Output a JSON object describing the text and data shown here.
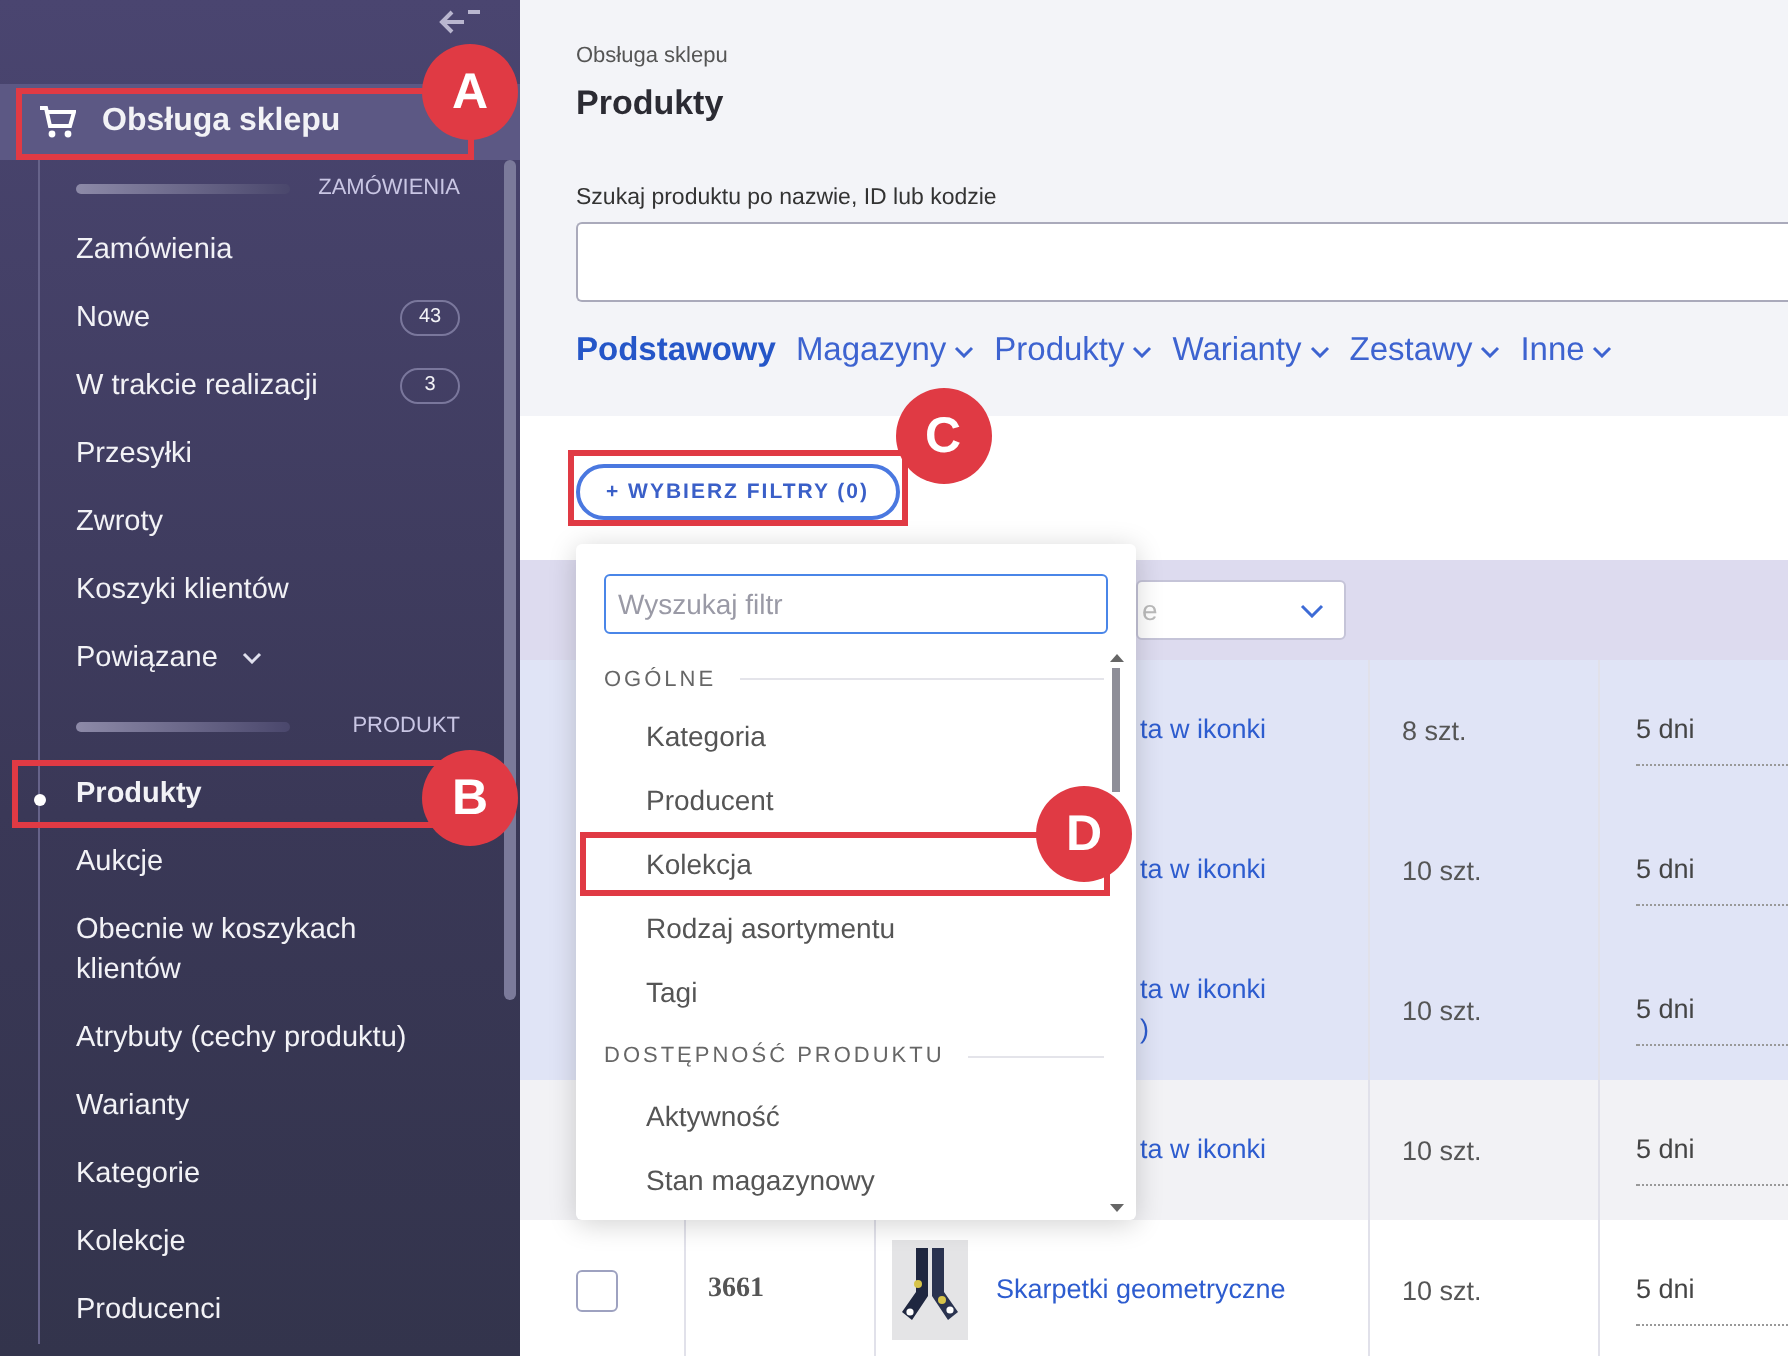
{
  "sidebar": {
    "module": {
      "label": "Obsługa sklepu",
      "selected": true,
      "annotation": "A"
    },
    "sections": [
      {
        "title": "ZAMÓWIENIA",
        "items": [
          {
            "label": "Zamówienia",
            "selected": false
          },
          {
            "label": "Nowe",
            "badge": "43",
            "selected": false
          },
          {
            "label": "W trakcie realizacji",
            "badge": "3",
            "selected": false
          },
          {
            "label": "Przesyłki",
            "selected": false
          },
          {
            "label": "Zwroty",
            "selected": false
          },
          {
            "label": "Koszyki klientów",
            "selected": false
          },
          {
            "label": "Powiązane",
            "selected": false,
            "expandable": true
          }
        ]
      },
      {
        "title": "PRODUKT",
        "items": [
          {
            "label": "Produkty",
            "selected": true,
            "annotation": "B"
          },
          {
            "label": "Aukcje",
            "selected": false
          },
          {
            "label": "Obecnie w koszykach klientów",
            "selected": false
          },
          {
            "label": "Atrybuty (cechy produktu)",
            "selected": false
          },
          {
            "label": "Warianty",
            "selected": false
          },
          {
            "label": "Kategorie",
            "selected": false
          },
          {
            "label": "Kolekcje",
            "selected": false
          },
          {
            "label": "Producenci",
            "selected": false
          }
        ]
      }
    ]
  },
  "breadcrumb": "Obsługa sklepu",
  "page_title": "Produkty",
  "search": {
    "label": "Szukaj produktu po nazwie, ID lub kodzie"
  },
  "tabs": [
    {
      "label": "Podstawowy",
      "selected": true,
      "has_menu": false
    },
    {
      "label": "Magazyny",
      "selected": false,
      "has_menu": true
    },
    {
      "label": "Produkty",
      "selected": false,
      "has_menu": true
    },
    {
      "label": "Warianty",
      "selected": false,
      "has_menu": true
    },
    {
      "label": "Zestawy",
      "selected": false,
      "has_menu": true
    },
    {
      "label": "Inne",
      "selected": false,
      "has_menu": true
    }
  ],
  "filter_button": {
    "label": "+ WYBIERZ FILTRY (0)",
    "annotation": "C"
  },
  "filter_menu": {
    "search": {
      "placeholder": "Wyszukaj filtr"
    },
    "groups": [
      {
        "title": "OGÓLNE",
        "items": [
          {
            "label": "Kategoria"
          },
          {
            "label": "Producent"
          },
          {
            "label": "Kolekcja",
            "annotation": "D"
          },
          {
            "label": "Rodzaj asortymentu"
          },
          {
            "label": "Tagi"
          }
        ]
      },
      {
        "title": "DOSTĘPNOŚĆ PRODUKTU",
        "items": [
          {
            "label": "Aktywność"
          },
          {
            "label": "Stan magazynowy"
          }
        ]
      }
    ]
  },
  "table": {
    "header_select": {
      "value": "e"
    },
    "rows": [
      {
        "selected": true,
        "hovered": false,
        "name": "ta w ikonki",
        "quantity": "8 szt.",
        "delivery": "5 dni"
      },
      {
        "selected": true,
        "hovered": false,
        "name": "ta w ikonki",
        "quantity": "10 szt.",
        "delivery": "5 dni"
      },
      {
        "selected": true,
        "hovered": false,
        "name": "ta w ikonki",
        "name_2": ")",
        "quantity": "10 szt.",
        "delivery": "5 dni"
      },
      {
        "selected": false,
        "hovered": true,
        "name": "ta w ikonki",
        "quantity": "10 szt.",
        "delivery": "5 dni"
      },
      {
        "selected": false,
        "hovered": false,
        "checked": false,
        "id": "3661",
        "name": "Skarpetki geometryczne",
        "quantity": "10 szt.",
        "delivery": "5 dni"
      }
    ]
  }
}
